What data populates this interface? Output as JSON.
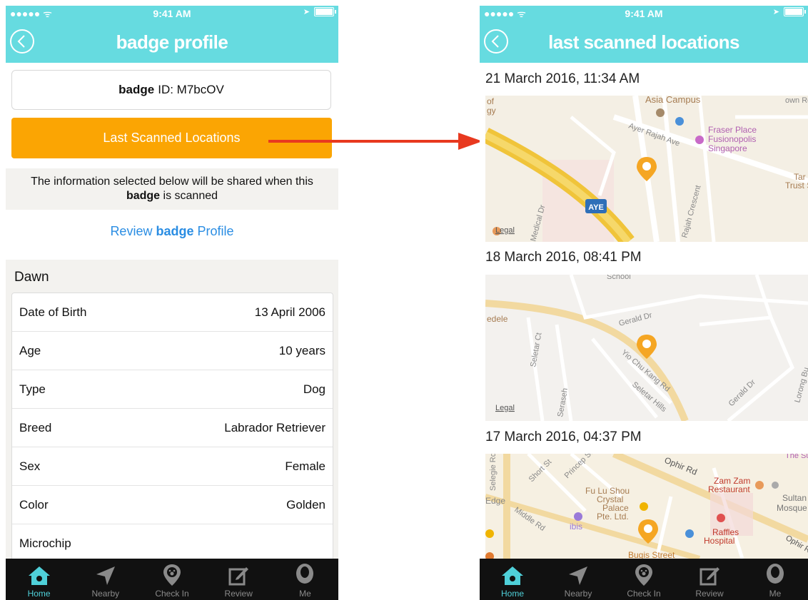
{
  "status_bar": {
    "signal": "●●●●● ᯤ",
    "time": "9:41 AM",
    "location_arrow": "➤"
  },
  "left_screen": {
    "title": "badge profile",
    "badge_id": {
      "brand": "badge",
      "label": "ID: M7bcOV"
    },
    "last_scanned_button": "Last Scanned Locations",
    "info_text": {
      "line1": "The information selected below will be shared when this",
      "brand": "badge",
      "line2_rest": "is scanned"
    },
    "review_link": {
      "prefix": "Review",
      "brand": "badge",
      "suffix": "Profile"
    },
    "pet_name": "Dawn",
    "details": [
      {
        "label": "Date of Birth",
        "value": "13 April 2006"
      },
      {
        "label": "Age",
        "value": "10 years"
      },
      {
        "label": "Type",
        "value": "Dog"
      },
      {
        "label": "Breed",
        "value": "Labrador Retriever"
      },
      {
        "label": "Sex",
        "value": "Female"
      },
      {
        "label": "Color",
        "value": "Golden"
      },
      {
        "label": "Microchip",
        "value": ""
      }
    ]
  },
  "right_screen": {
    "title": "last scanned locations",
    "locations": [
      {
        "date": "21 March 2016, 11:34 AM",
        "map_labels": {
          "a": "of",
          "b": "gy",
          "c": "Asia Campus",
          "d": "Ayer Rajah Ave",
          "e": "Fraser Place",
          "f": "Fusionopolis",
          "g": "Singapore",
          "h": "Tar",
          "i": "Trust Sc",
          "j": "AYE",
          "k": "Rajah Crescent",
          "l": "Medical Dr",
          "m": "Legal",
          "n": "own Rd"
        }
      },
      {
        "date": "18 March 2016, 08:41 PM",
        "map_labels": {
          "a": "School",
          "b": "edele",
          "c": "Gerald Dr",
          "d": "Seletar Ct",
          "e": "Yio Chu Kang Rd",
          "f": "Seletar Hills",
          "g": "Gerald Dr",
          "h": "Lorong Bu",
          "i": "Legal",
          "j": "Seraseh"
        }
      },
      {
        "date": "17 March 2016, 04:37 PM",
        "map_labels": {
          "a": "Ophir Rd",
          "b": "Princep St",
          "c": "Short St",
          "d": "Zam Zam",
          "e": "Restaurant",
          "f": "Sultan",
          "g": "Mosque",
          "h": "Fu Lu Shou",
          "i": "Crystal",
          "j": "Palace",
          "k": "Pte. Ltd.",
          "l": "Middle Rd",
          "m": "ibis",
          "n": "Raffles",
          "o": "Hospital",
          "p": "Bugis Street",
          "q": "Ophir Rd",
          "r": "Edge",
          "s": "The Sun"
        }
      }
    ]
  },
  "tabbar": {
    "tabs": [
      {
        "label": "Home",
        "icon": "home-icon"
      },
      {
        "label": "Nearby",
        "icon": "location-arrow-icon"
      },
      {
        "label": "Check In",
        "icon": "paw-pin-icon"
      },
      {
        "label": "Review",
        "icon": "edit-icon"
      },
      {
        "label": "Me",
        "icon": "person-icon"
      }
    ]
  },
  "colors": {
    "header": "#66dbe0",
    "button": "#fba503",
    "link": "#2a8de3",
    "tabbar": "#111111",
    "active_tab": "#4fd0d9",
    "pin": "#f5a623",
    "arrow": "#e8391f"
  }
}
